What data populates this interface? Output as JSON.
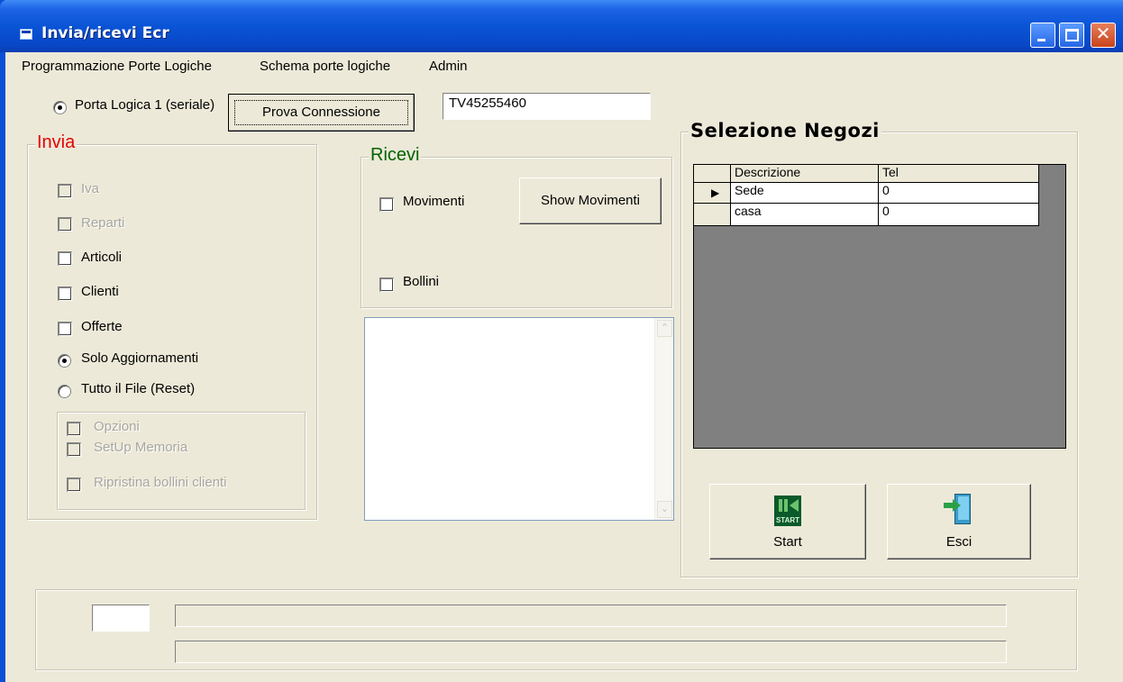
{
  "window": {
    "title": "Invia/ricevi Ecr"
  },
  "menu": {
    "items": [
      "Programmazione Porte Logiche",
      "Schema porte logiche",
      "Admin"
    ]
  },
  "connection": {
    "port_label": "Porta Logica 1 (seriale)",
    "test_button": "Prova Connessione",
    "serial_value": "TV45255460"
  },
  "invia": {
    "title": "Invia",
    "title_color": "#e60000",
    "options": {
      "iva": "Iva",
      "reparti": "Reparti",
      "articoli": "Articoli",
      "clienti": "Clienti",
      "offerte": "Offerte"
    },
    "mode_update": "Solo Aggiornamenti",
    "mode_reset": "Tutto il File (Reset)",
    "extra": {
      "opzioni": "Opzioni",
      "setup_memoria": "SetUp Memoria",
      "ripristina": "Ripristina bollini clienti"
    }
  },
  "ricevi": {
    "title": "Ricevi",
    "title_color": "#006400",
    "movimenti": "Movimenti",
    "show_movimenti": "Show Movimenti",
    "bollini": "Bollini"
  },
  "negozi": {
    "title": "Selezione Negozi",
    "columns": [
      "Descrizione",
      "Tel"
    ],
    "rows": [
      {
        "descrizione": "Sede",
        "tel": "0"
      },
      {
        "descrizione": "casa",
        "tel": "0"
      }
    ],
    "current_row_indicator": "▶"
  },
  "actions": {
    "start_label": "Start",
    "start_icon_text": "START",
    "esci_label": "Esci"
  },
  "colors": {
    "titlebar": "#0a54d6",
    "window_bg": "#ece9d8"
  }
}
